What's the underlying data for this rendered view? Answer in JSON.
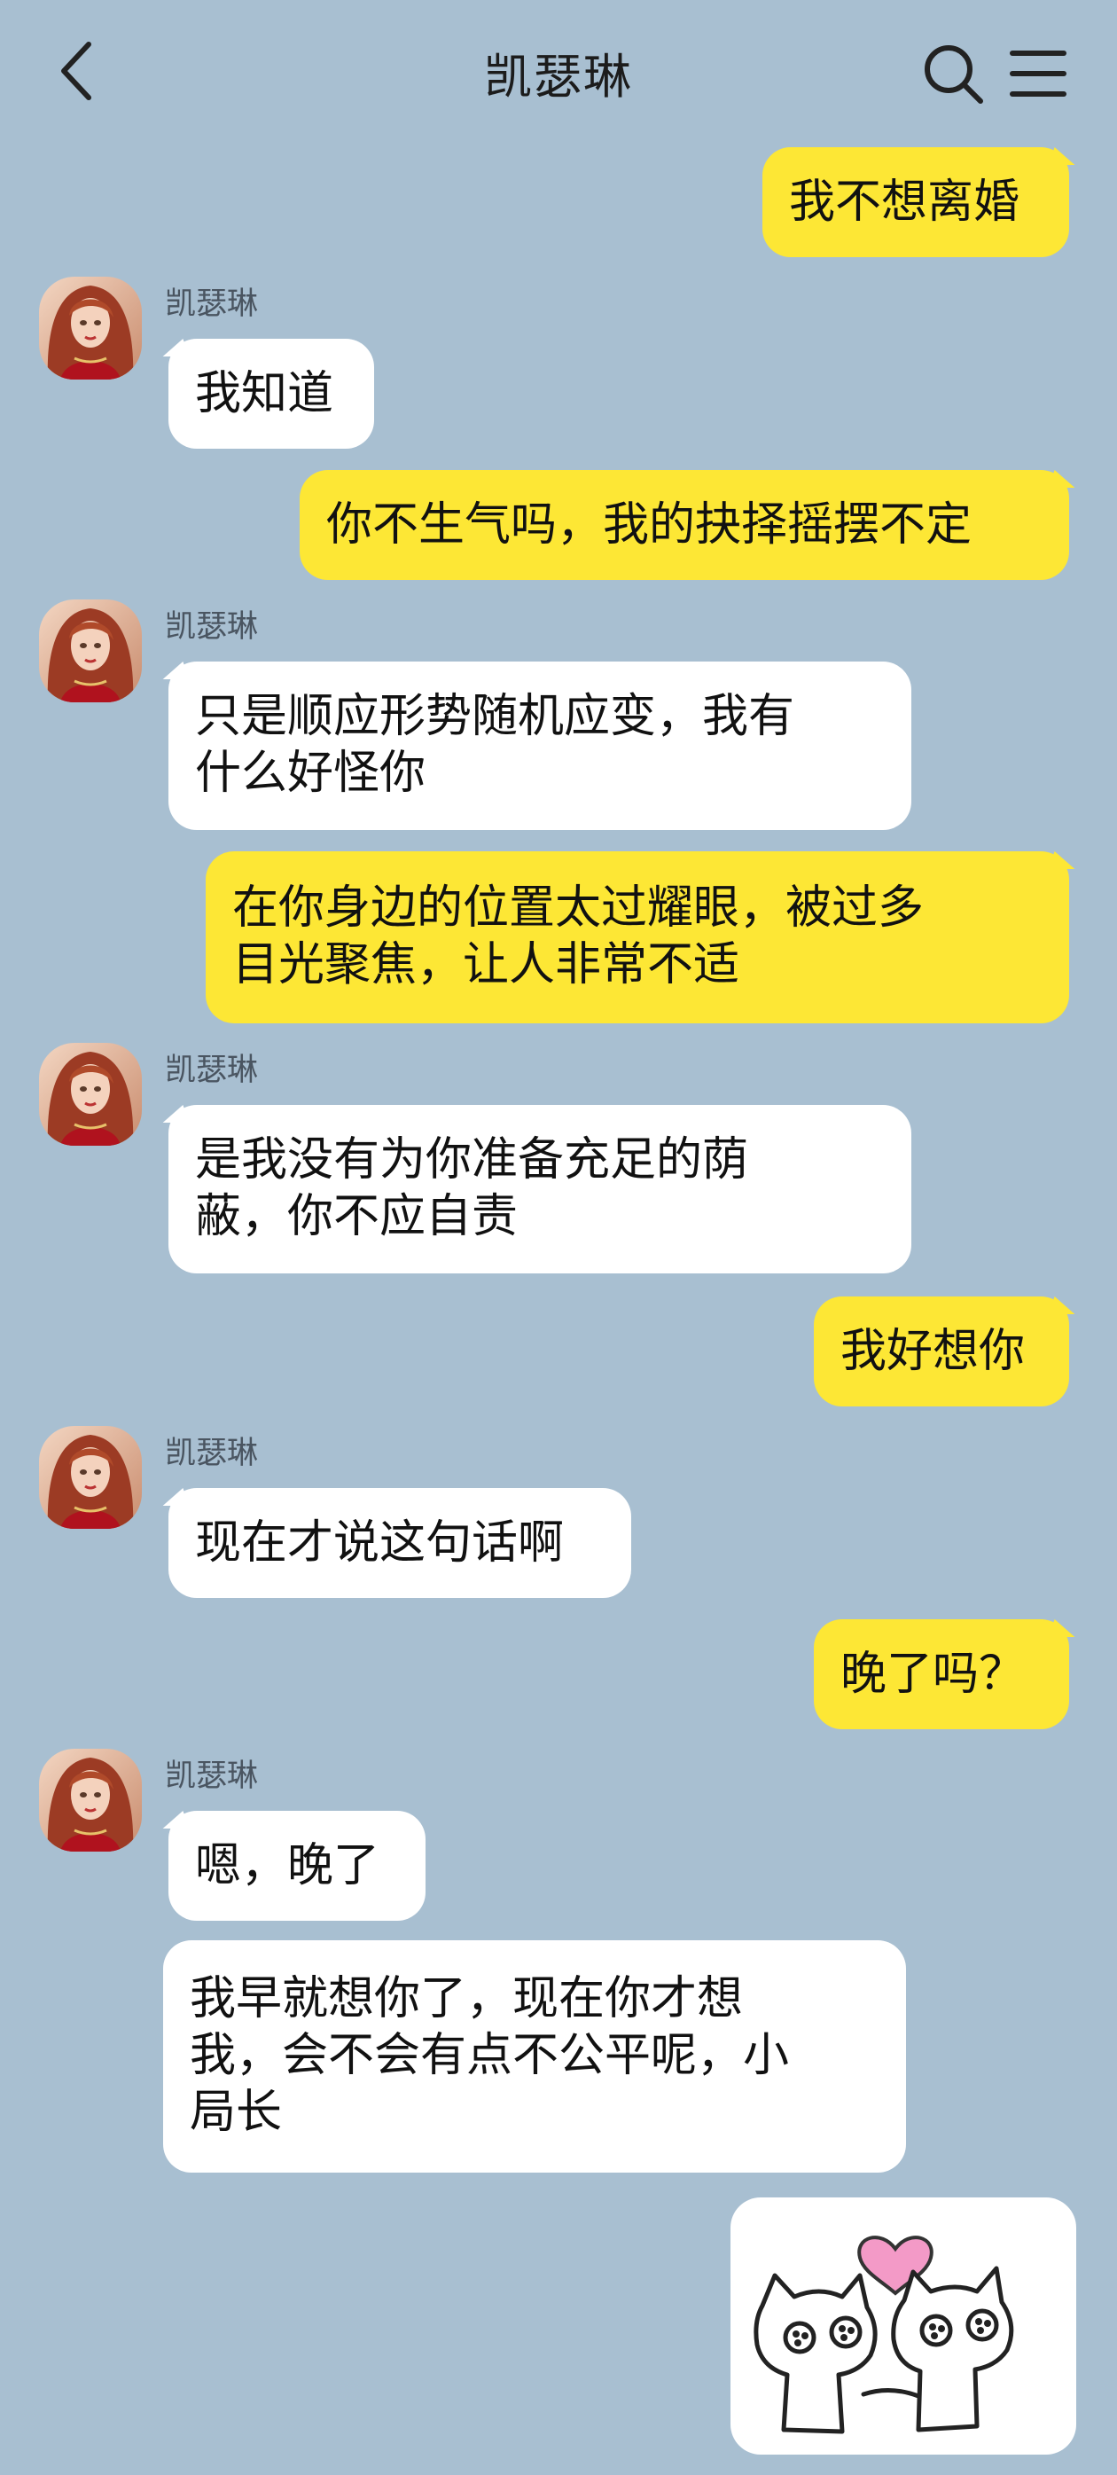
{
  "header": {
    "title": "凯瑟琳",
    "back_icon": "chevron-left-icon",
    "search_icon": "search-icon",
    "menu_icon": "hamburger-menu-icon"
  },
  "contact": {
    "name": "凯瑟琳",
    "avatar": "red-haired-woman-avatar"
  },
  "colors": {
    "background": "#a8bfd1",
    "my_bubble": "#fde735",
    "their_bubble": "#ffffff"
  },
  "messages": [
    {
      "from": "me",
      "lines": [
        "我不想离婚"
      ]
    },
    {
      "from": "them",
      "sender": "凯瑟琳",
      "lines": [
        "我知道"
      ]
    },
    {
      "from": "me",
      "lines": [
        "你不生气吗，我的抉择摇摆不定"
      ]
    },
    {
      "from": "them",
      "sender": "凯瑟琳",
      "lines": [
        "只是顺应形势随机应变，我有",
        "什么好怪你"
      ]
    },
    {
      "from": "me",
      "lines": [
        "在你身边的位置太过耀眼，被过多",
        "目光聚焦，让人非常不适"
      ]
    },
    {
      "from": "them",
      "sender": "凯瑟琳",
      "lines": [
        "是我没有为你准备充足的荫",
        "蔽，你不应自责"
      ]
    },
    {
      "from": "me",
      "lines": [
        "我好想你"
      ]
    },
    {
      "from": "them",
      "sender": "凯瑟琳",
      "lines": [
        "现在才说这句话啊"
      ]
    },
    {
      "from": "me",
      "lines": [
        "晚了吗？"
      ]
    },
    {
      "from": "them",
      "sender": "凯瑟琳",
      "lines": [
        "嗯，晚了"
      ]
    },
    {
      "from": "them",
      "lines": [
        "我早就想你了，现在你才想",
        "我，会不会有点不公平呢，小",
        "局长"
      ]
    },
    {
      "from": "me",
      "sticker": "two-cats-holding-hands-heart-sticker"
    }
  ]
}
